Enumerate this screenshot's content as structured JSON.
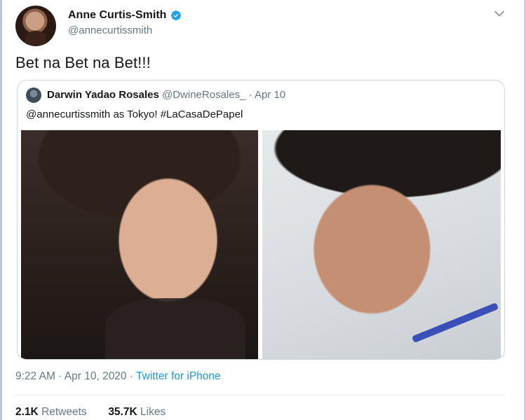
{
  "author": {
    "name": "Anne Curtis-Smith",
    "handle": "@annecurtissmith"
  },
  "tweet": {
    "text": "Bet na Bet na Bet!!!"
  },
  "quoted_tweet": {
    "name": "Darwin Yadao Rosales",
    "handle": "@DwineRosales_",
    "separator": " · ",
    "date": "Apr 10",
    "text": "@annecurtissmith as Tokyo! #LaCasaDePapel"
  },
  "meta": {
    "time_date": "9:22 AM · Apr 10, 2020 · ",
    "source": "Twitter for iPhone"
  },
  "stats": {
    "retweets_count": "2.1K",
    "retweets_label": "Retweets",
    "likes_count": "35.7K",
    "likes_label": "Likes"
  },
  "icons": {
    "verified": "verified-badge-icon",
    "menu": "chevron-down-icon"
  },
  "colors": {
    "verified_blue": "#1da1f2",
    "link_blue": "#1b95e0",
    "secondary_text": "#657786"
  }
}
